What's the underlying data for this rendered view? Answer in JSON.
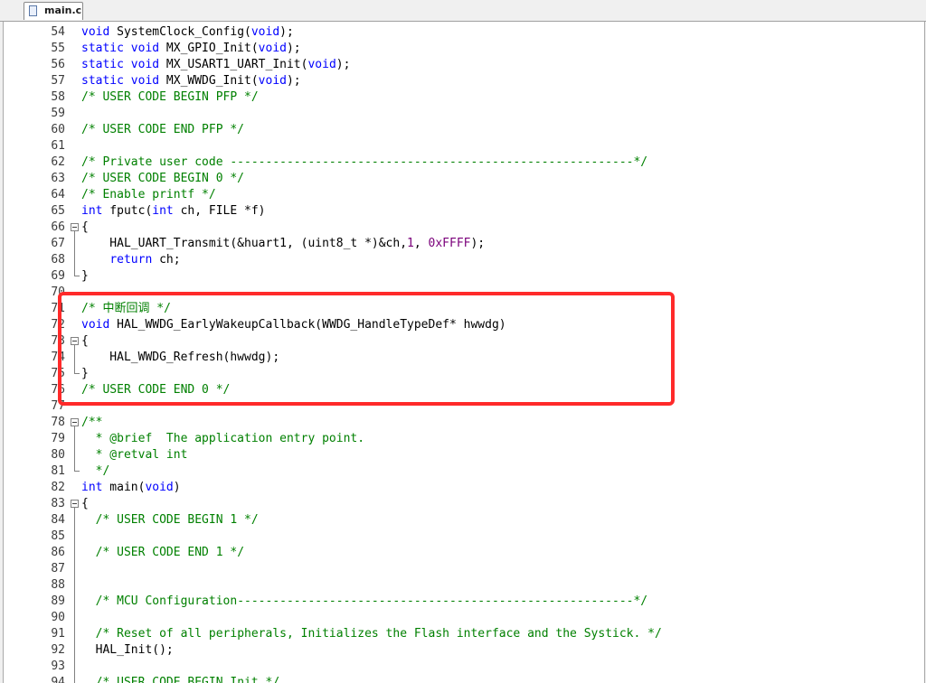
{
  "tab": {
    "label": "main.c",
    "icon": "c-file-icon"
  },
  "colors": {
    "keyword": "#0000ff",
    "comment": "#008000",
    "number": "#7a007a",
    "highlight": "#ff2a2a"
  },
  "lines": [
    {
      "n": "54",
      "fold": "",
      "segs": [
        [
          "k",
          "void"
        ],
        [
          "t",
          " SystemClock_Config("
        ],
        [
          "k",
          "void"
        ],
        [
          "t",
          ");"
        ]
      ]
    },
    {
      "n": "55",
      "fold": "",
      "segs": [
        [
          "k",
          "static void"
        ],
        [
          "t",
          " MX_GPIO_Init("
        ],
        [
          "k",
          "void"
        ],
        [
          "t",
          ");"
        ]
      ]
    },
    {
      "n": "56",
      "fold": "",
      "segs": [
        [
          "k",
          "static void"
        ],
        [
          "t",
          " MX_USART1_UART_Init("
        ],
        [
          "k",
          "void"
        ],
        [
          "t",
          ");"
        ]
      ]
    },
    {
      "n": "57",
      "fold": "",
      "segs": [
        [
          "k",
          "static void"
        ],
        [
          "t",
          " MX_WWDG_Init("
        ],
        [
          "k",
          "void"
        ],
        [
          "t",
          ");"
        ]
      ]
    },
    {
      "n": "58",
      "fold": "",
      "segs": [
        [
          "c",
          "/* USER CODE BEGIN PFP */"
        ]
      ]
    },
    {
      "n": "59",
      "fold": "",
      "segs": []
    },
    {
      "n": "60",
      "fold": "",
      "segs": [
        [
          "c",
          "/* USER CODE END PFP */"
        ]
      ]
    },
    {
      "n": "61",
      "fold": "",
      "segs": []
    },
    {
      "n": "62",
      "fold": "",
      "segs": [
        [
          "c",
          "/* Private user code ---------------------------------------------------------*/"
        ]
      ]
    },
    {
      "n": "63",
      "fold": "",
      "segs": [
        [
          "c",
          "/* USER CODE BEGIN 0 */"
        ]
      ]
    },
    {
      "n": "64",
      "fold": "",
      "segs": [
        [
          "c",
          "/* Enable printf */"
        ]
      ]
    },
    {
      "n": "65",
      "fold": "",
      "segs": [
        [
          "k",
          "int"
        ],
        [
          "t",
          " fputc("
        ],
        [
          "k",
          "int"
        ],
        [
          "t",
          " ch, FILE *f)"
        ]
      ]
    },
    {
      "n": "66",
      "fold": "open",
      "segs": [
        [
          "t",
          "{"
        ]
      ]
    },
    {
      "n": "67",
      "fold": "mid",
      "segs": [
        [
          "t",
          "    HAL_UART_Transmit(&huart1, (uint8_t *)&ch,"
        ],
        [
          "m",
          "1"
        ],
        [
          "t",
          ", "
        ],
        [
          "m",
          "0xFFFF"
        ],
        [
          "t",
          ");"
        ]
      ]
    },
    {
      "n": "68",
      "fold": "mid",
      "segs": [
        [
          "t",
          "    "
        ],
        [
          "k",
          "return"
        ],
        [
          "t",
          " ch;"
        ]
      ]
    },
    {
      "n": "69",
      "fold": "end",
      "segs": [
        [
          "t",
          "}"
        ]
      ]
    },
    {
      "n": "70",
      "fold": "",
      "segs": []
    },
    {
      "n": "71",
      "fold": "",
      "segs": [
        [
          "c",
          "/* 中断回调 */"
        ]
      ]
    },
    {
      "n": "72",
      "fold": "",
      "segs": [
        [
          "k",
          "void"
        ],
        [
          "t",
          " HAL_WWDG_EarlyWakeupCallback(WWDG_HandleTypeDef* hwwdg)"
        ]
      ]
    },
    {
      "n": "73",
      "fold": "open",
      "segs": [
        [
          "t",
          "{"
        ]
      ]
    },
    {
      "n": "74",
      "fold": "mid",
      "segs": [
        [
          "t",
          "    HAL_WWDG_Refresh(hwwdg);"
        ]
      ]
    },
    {
      "n": "75",
      "fold": "end",
      "segs": [
        [
          "t",
          "}"
        ]
      ]
    },
    {
      "n": "76",
      "fold": "",
      "segs": [
        [
          "c",
          "/* USER CODE END 0 */"
        ]
      ]
    },
    {
      "n": "77",
      "fold": "",
      "segs": []
    },
    {
      "n": "78",
      "fold": "open",
      "segs": [
        [
          "c",
          "/**"
        ]
      ]
    },
    {
      "n": "79",
      "fold": "mid",
      "segs": [
        [
          "c",
          "  * @brief  The application entry point."
        ]
      ]
    },
    {
      "n": "80",
      "fold": "mid",
      "segs": [
        [
          "c",
          "  * @retval int"
        ]
      ]
    },
    {
      "n": "81",
      "fold": "end",
      "segs": [
        [
          "c",
          "  */"
        ]
      ]
    },
    {
      "n": "82",
      "fold": "",
      "segs": [
        [
          "k",
          "int"
        ],
        [
          "t",
          " main("
        ],
        [
          "k",
          "void"
        ],
        [
          "t",
          ")"
        ]
      ]
    },
    {
      "n": "83",
      "fold": "open",
      "segs": [
        [
          "t",
          "{"
        ]
      ]
    },
    {
      "n": "84",
      "fold": "mid",
      "segs": [
        [
          "t",
          "  "
        ],
        [
          "c",
          "/* USER CODE BEGIN 1 */"
        ]
      ]
    },
    {
      "n": "85",
      "fold": "mid",
      "segs": []
    },
    {
      "n": "86",
      "fold": "mid",
      "segs": [
        [
          "t",
          "  "
        ],
        [
          "c",
          "/* USER CODE END 1 */"
        ]
      ]
    },
    {
      "n": "87",
      "fold": "mid",
      "segs": []
    },
    {
      "n": "88",
      "fold": "mid",
      "segs": []
    },
    {
      "n": "89",
      "fold": "mid",
      "segs": [
        [
          "t",
          "  "
        ],
        [
          "c",
          "/* MCU Configuration--------------------------------------------------------*/"
        ]
      ]
    },
    {
      "n": "90",
      "fold": "mid",
      "segs": []
    },
    {
      "n": "91",
      "fold": "mid",
      "segs": [
        [
          "t",
          "  "
        ],
        [
          "c",
          "/* Reset of all peripherals, Initializes the Flash interface and the Systick. */"
        ]
      ]
    },
    {
      "n": "92",
      "fold": "mid",
      "segs": [
        [
          "t",
          "  HAL_Init();"
        ]
      ]
    },
    {
      "n": "93",
      "fold": "mid",
      "segs": []
    },
    {
      "n": "94",
      "fold": "mid",
      "segs": [
        [
          "t",
          "  "
        ],
        [
          "c",
          "/* USER CODE BEGIN Init */"
        ]
      ]
    }
  ]
}
